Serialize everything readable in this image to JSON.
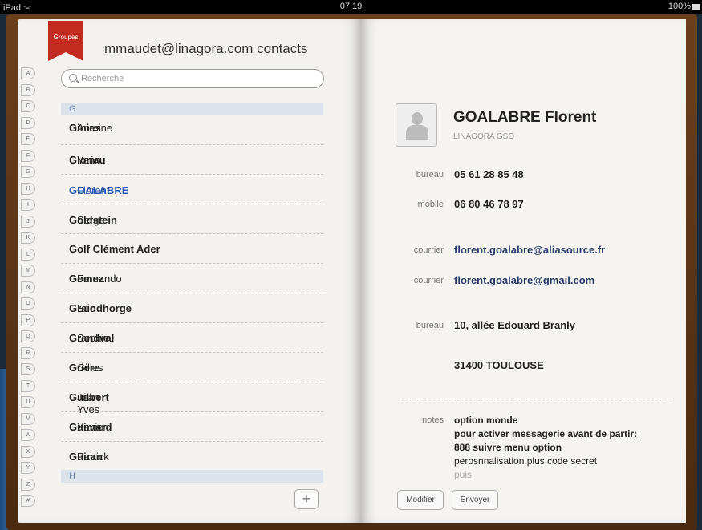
{
  "status": {
    "device": "iPad",
    "wifi": "ᯤ",
    "time": "07:19",
    "battery": "100%"
  },
  "groups_label": "Groupes",
  "contacts_title": "mmaudet@linagora.com contacts",
  "search": {
    "placeholder": "Recherche"
  },
  "index_letters": [
    "A",
    "B",
    "C",
    "D",
    "E",
    "F",
    "G",
    "H",
    "I",
    "J",
    "K",
    "L",
    "M",
    "N",
    "O",
    "P",
    "Q",
    "R",
    "S",
    "T",
    "U",
    "V",
    "W",
    "X",
    "Y",
    "Z",
    "#"
  ],
  "sections": [
    {
      "label": "G"
    },
    {
      "label": "H"
    }
  ],
  "contacts": [
    {
      "bold": "Ginies",
      "rest": " Antoine"
    },
    {
      "bold": "Gloriau",
      "rest": " Yann"
    },
    {
      "bold": "GOALABRE",
      "rest": " Florent",
      "active": true
    },
    {
      "bold": "Goldstein",
      "rest": " Serge"
    },
    {
      "bold": "Golf Clément Ader",
      "rest": ""
    },
    {
      "bold": "Gomez",
      "rest": " Fernando"
    },
    {
      "bold": "Graindhorge",
      "rest": " Eric"
    },
    {
      "bold": "Grandval",
      "rest": " Sophie"
    },
    {
      "bold": "Griere",
      "rest": " Gilles"
    },
    {
      "bold": "Guilbert",
      "rest": " Jean Yves"
    },
    {
      "bold": "Guimard",
      "rest": " Xavier"
    },
    {
      "bold": "Guiran",
      "rest": " Patrick"
    }
  ],
  "add_button": "+",
  "detail": {
    "name": "GOALABRE Florent",
    "company": "LINAGORA GSO",
    "fields": [
      {
        "label": "bureau",
        "value": "05 61 28 85 48"
      },
      {
        "label": "mobile",
        "value": "06 80 46 78 97"
      },
      {
        "label": "courrier",
        "value": "florent.goalabre@aliasource.fr"
      },
      {
        "label": "courrier",
        "value": "florent.goalabre@gmail.com"
      },
      {
        "label": "bureau",
        "value": "10, allée Edouard Branly"
      },
      {
        "label": "",
        "value": "31400 TOULOUSE"
      }
    ],
    "notes_label": "notes",
    "notes": [
      "option monde",
      "pour activer messagerie avant de partir:",
      "888 suivre menu option",
      "perosnnalisation plus code secret",
      "puis"
    ]
  },
  "buttons": {
    "edit": "Modifier",
    "send": "Envoyer"
  }
}
